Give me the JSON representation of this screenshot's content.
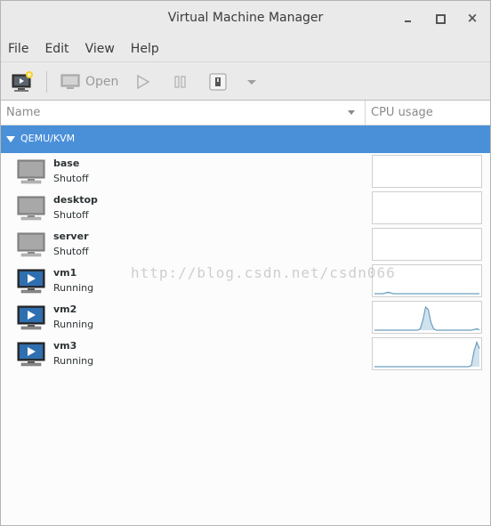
{
  "window": {
    "title": "Virtual Machine Manager",
    "minimize_icon": "minimize-icon",
    "maximize_icon": "maximize-icon",
    "close_symbol": "×"
  },
  "menu": [
    "File",
    "Edit",
    "View",
    "Help"
  ],
  "toolbar": {
    "new_vm_icon": "new-vm-icon",
    "open_label": "Open",
    "run_icon": "play-icon",
    "pause_icon": "pause-icon",
    "shutdown_icon": "shutdown-icon",
    "menu_icon": "dropdown-arrow-icon"
  },
  "columns": {
    "name": "Name",
    "cpu": "CPU usage"
  },
  "group": {
    "label": "QEMU/KVM"
  },
  "vms": [
    {
      "name": "base",
      "status": "Shutoff",
      "state": "off",
      "cpu": []
    },
    {
      "name": "desktop",
      "status": "Shutoff",
      "state": "off",
      "cpu": []
    },
    {
      "name": "server",
      "status": "Shutoff",
      "state": "off",
      "cpu": []
    },
    {
      "name": "vm1",
      "status": "Running",
      "state": "on",
      "cpu": [
        0,
        0,
        0,
        0,
        2,
        6,
        3,
        0,
        0,
        0,
        0,
        0,
        0,
        0,
        0,
        0,
        0,
        0,
        0,
        0,
        0,
        0,
        0,
        0,
        0,
        0,
        0,
        0,
        0,
        0,
        0,
        0,
        0,
        0,
        0,
        0,
        0,
        0,
        0,
        0
      ]
    },
    {
      "name": "vm2",
      "status": "Running",
      "state": "on",
      "cpu": [
        0,
        0,
        0,
        0,
        0,
        0,
        0,
        0,
        0,
        0,
        0,
        0,
        0,
        0,
        0,
        0,
        0,
        5,
        40,
        90,
        80,
        30,
        5,
        0,
        0,
        0,
        0,
        0,
        0,
        0,
        0,
        0,
        0,
        0,
        0,
        0,
        0,
        2,
        6,
        1
      ]
    },
    {
      "name": "vm3",
      "status": "Running",
      "state": "on",
      "cpu": [
        0,
        0,
        0,
        0,
        0,
        0,
        0,
        0,
        0,
        0,
        0,
        0,
        0,
        0,
        0,
        0,
        0,
        0,
        0,
        0,
        0,
        0,
        0,
        0,
        0,
        0,
        0,
        0,
        0,
        0,
        0,
        0,
        0,
        0,
        0,
        0,
        5,
        60,
        95,
        70
      ]
    }
  ],
  "watermark": "http://blog.csdn.net/csdn066",
  "colors": {
    "selection": "#4a90d9",
    "graph_line": "#6a9fbd",
    "graph_fill": "#cfe2ee"
  }
}
